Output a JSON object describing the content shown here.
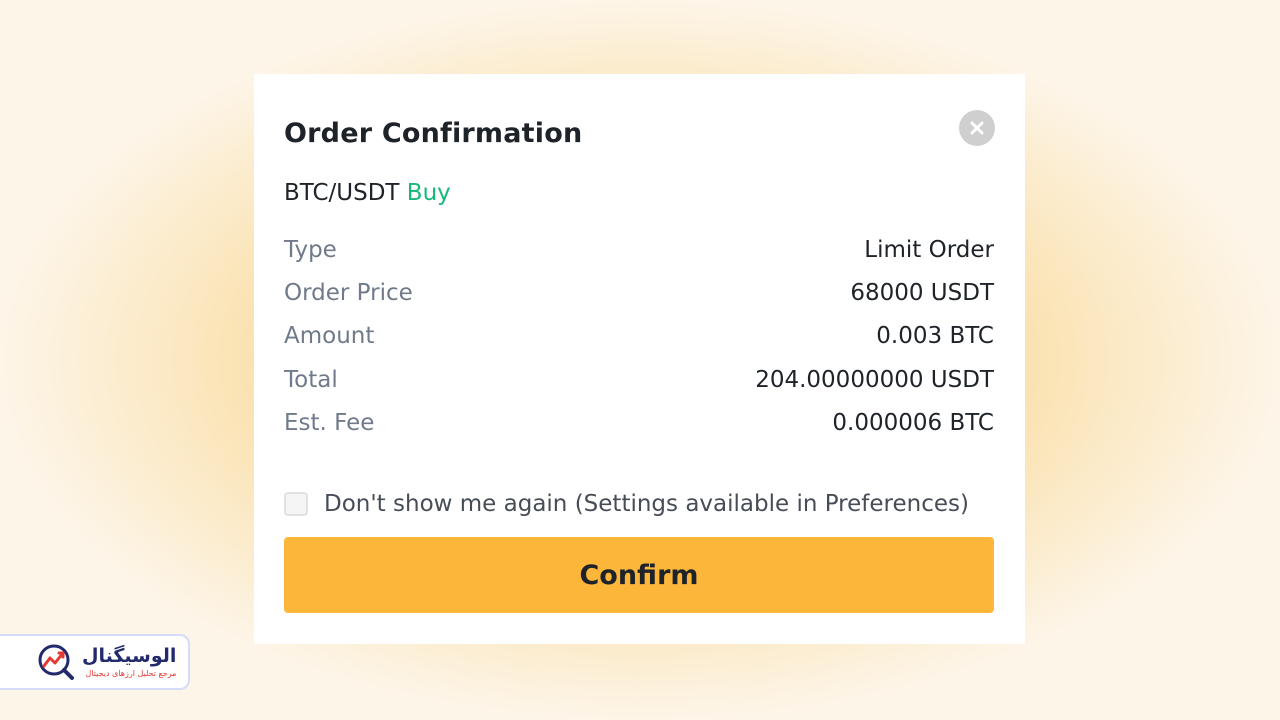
{
  "dialog": {
    "title": "Order Confirmation",
    "pair": "BTC/USDT",
    "side": "Buy",
    "rows": [
      {
        "label": "Type",
        "value": "Limit Order"
      },
      {
        "label": "Order Price",
        "value": "68000 USDT"
      },
      {
        "label": "Amount",
        "value": "0.003 BTC"
      },
      {
        "label": "Total",
        "value": "204.00000000 USDT"
      },
      {
        "label": "Est. Fee",
        "value": "0.000006 BTC"
      }
    ],
    "checkbox_label": "Don't show me again (Settings available in Preferences)",
    "checkbox_checked": false,
    "confirm_label": "Confirm"
  },
  "watermark": {
    "name": "الوسیگنال",
    "tagline": "مرجع تحلیل ارزهای دیجیتال"
  },
  "colors": {
    "buy": "#16b979",
    "confirm_button": "#fcb73b",
    "text_primary": "#1e2329",
    "text_secondary": "#707a8a"
  }
}
